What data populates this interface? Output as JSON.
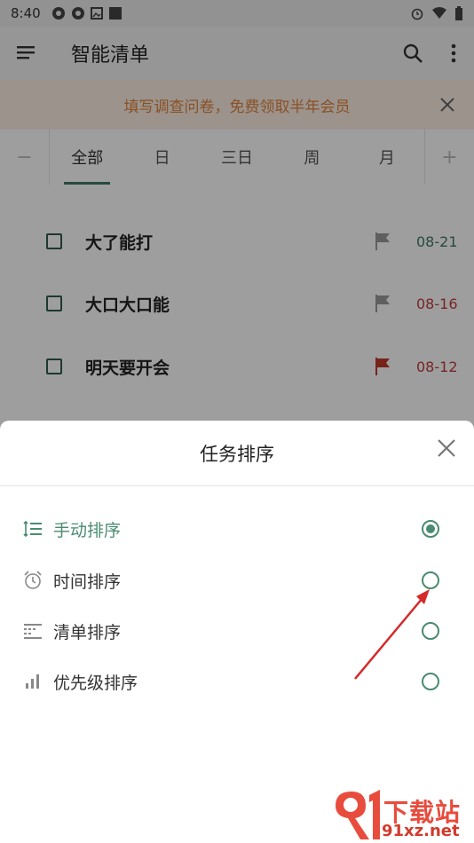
{
  "status_bar": {
    "time": "8:40"
  },
  "app_bar": {
    "title": "智能清单",
    "menu_icon": "hamburger-menu-icon",
    "search_icon": "search-icon",
    "more_icon": "more-vert-icon"
  },
  "banner": {
    "text": "填写调查问卷，免费领取半年会员"
  },
  "tabs": {
    "prev": "−",
    "next": "+",
    "items": [
      {
        "label": "全部",
        "active": true
      },
      {
        "label": "日",
        "active": false
      },
      {
        "label": "三日",
        "active": false
      },
      {
        "label": "周",
        "active": false
      },
      {
        "label": "月",
        "active": false
      }
    ]
  },
  "tasks": [
    {
      "name": "大了能打",
      "date": "08-21",
      "flag_color": "#9a9a9a",
      "date_color": "#3f7a63"
    },
    {
      "name": "大口大口能",
      "date": "08-16",
      "flag_color": "#9a9a9a",
      "date_color": "#c23b3b"
    },
    {
      "name": "明天要开会",
      "date": "08-12",
      "flag_color": "#c0392b",
      "date_color": "#c23b3b"
    }
  ],
  "sort_sheet": {
    "title": "任务排序",
    "options": [
      {
        "label": "手动排序",
        "icon": "manual-sort-icon",
        "selected": true
      },
      {
        "label": "时间排序",
        "icon": "alarm-clock-icon",
        "selected": false
      },
      {
        "label": "清单排序",
        "icon": "list-grid-icon",
        "selected": false
      },
      {
        "label": "优先级排序",
        "icon": "priority-bars-icon",
        "selected": false
      }
    ]
  },
  "watermark": {
    "title": "下载站",
    "url": "91xz.net"
  },
  "colors": {
    "accent": "#4a8b70",
    "banner_text": "#e0823c",
    "red": "#c23b3b"
  }
}
